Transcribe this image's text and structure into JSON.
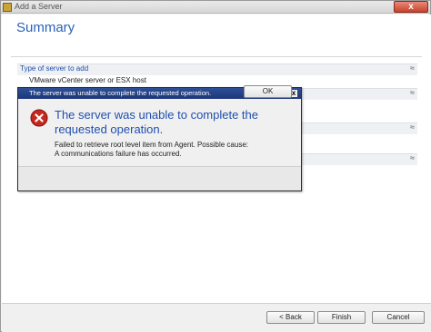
{
  "window": {
    "title": "Add a Server",
    "close_label": "x"
  },
  "page": {
    "title": "Summary"
  },
  "sections": [
    {
      "label": "Type of server to add",
      "value": "VMware vCenter server or ESX host",
      "chevron": "≈"
    },
    {
      "label": "",
      "value": "",
      "chevron": "≈"
    },
    {
      "label": "",
      "value": "",
      "chevron": "≈"
    },
    {
      "label": "",
      "value": "",
      "chevron": "≈"
    }
  ],
  "dialog": {
    "title": "The server was unable to complete the requested operation.",
    "close_label": "x",
    "heading": "The server was unable to complete the requested operation.",
    "message_line1": "Failed to retrieve root level item from Agent.  Possible cause:",
    "message_line2": "A communications failure has occurred.",
    "ok_label": "OK",
    "icon": "error-icon"
  },
  "buttons": {
    "back": "< Back",
    "finish": "Finish",
    "cancel": "Cancel"
  },
  "colors": {
    "accent": "#2a62b8",
    "dialog_title_bg": "#1c3679",
    "error_red": "#c8271e"
  }
}
